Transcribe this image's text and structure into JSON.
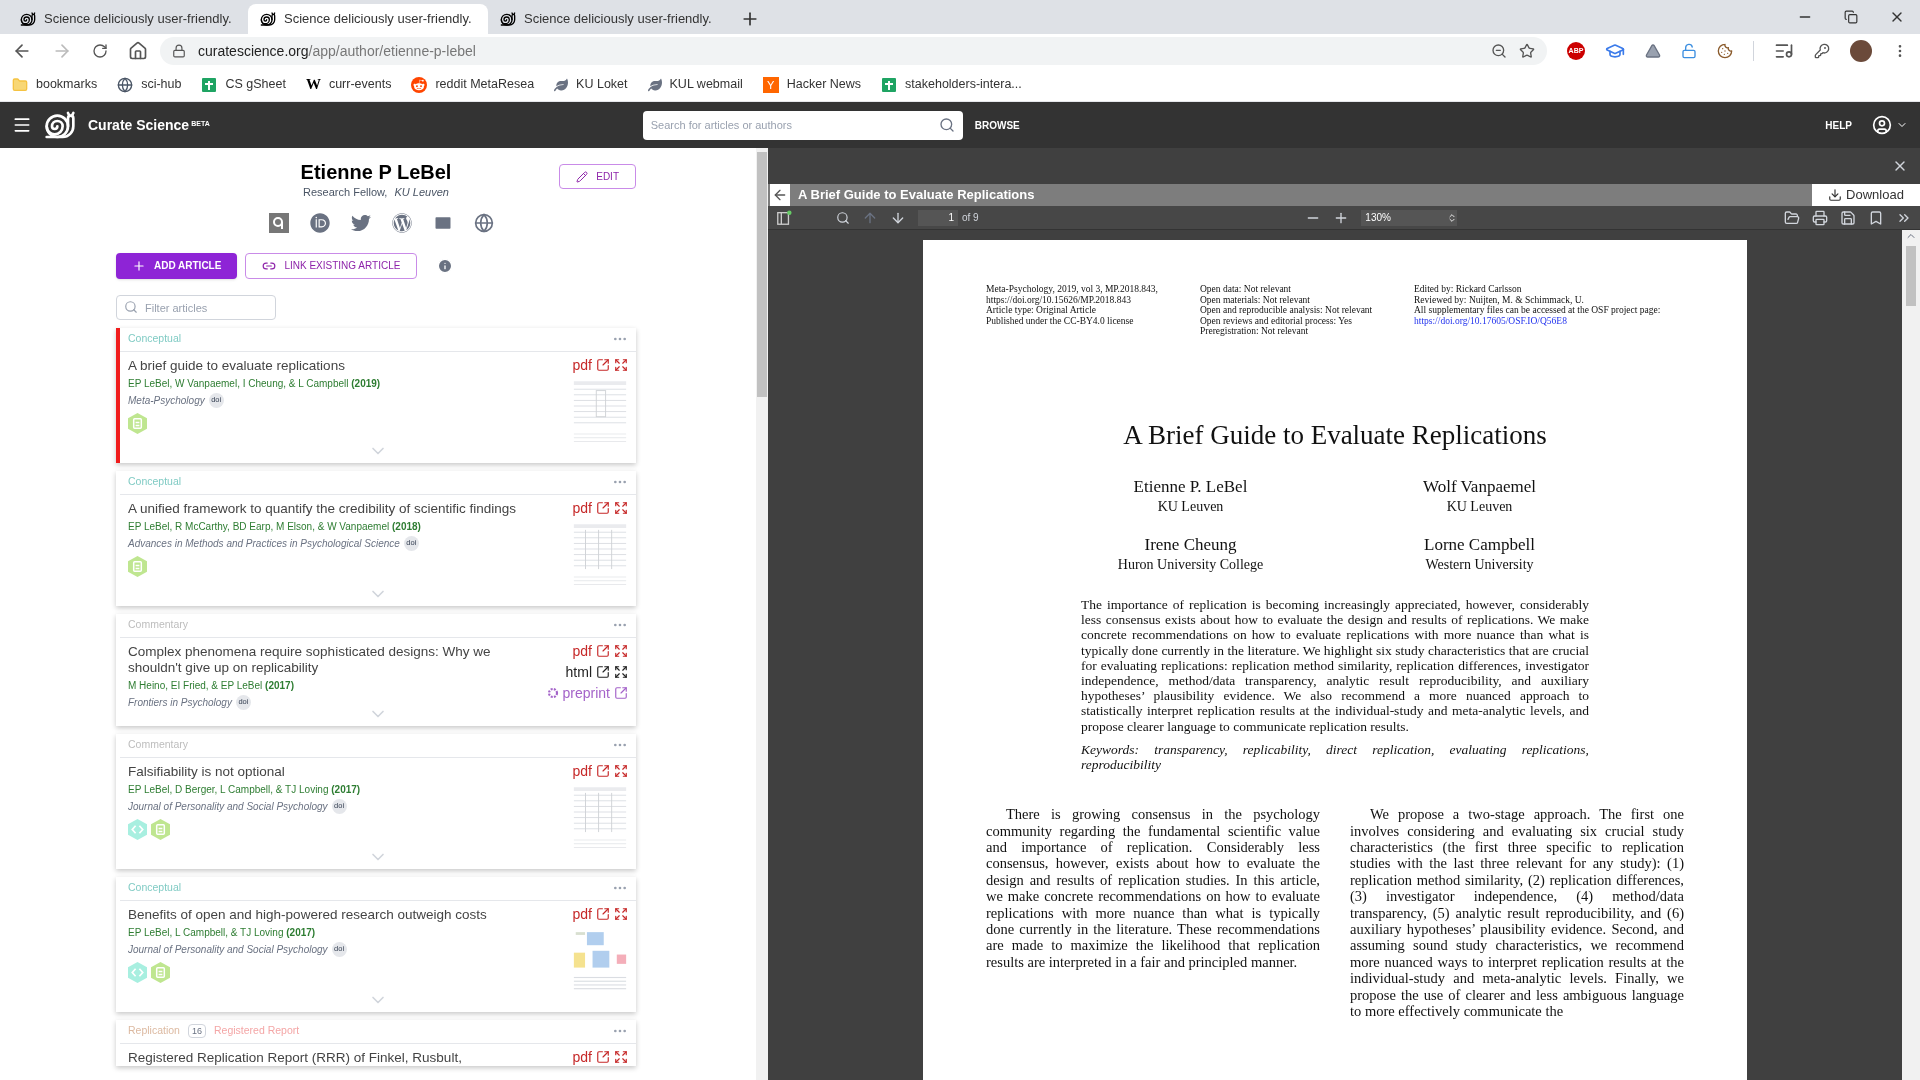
{
  "browser": {
    "tabs": [
      {
        "title": "Science deliciously user-friendly.",
        "selected": false
      },
      {
        "title": "Science deliciously user-friendly.",
        "selected": true
      },
      {
        "title": "Science deliciously user-friendly.",
        "selected": false
      }
    ],
    "url_host": "curatescience.org",
    "url_path": "/app/author/etienne-p-lebel",
    "adblock_label": "ABP",
    "bookmarks": [
      {
        "label": "bookmarks",
        "kind": "folder"
      },
      {
        "label": "sci-hub",
        "kind": "globe"
      },
      {
        "label": "CS gSheet",
        "kind": "sheet"
      },
      {
        "label": "curr-events",
        "kind": "letter",
        "glyph": "W"
      },
      {
        "label": "reddit MetaResea",
        "kind": "reddit"
      },
      {
        "label": "KU Loket",
        "kind": "leaf"
      },
      {
        "label": "KUL webmail",
        "kind": "leaf"
      },
      {
        "label": "Hacker News",
        "kind": "boxed",
        "glyph": "Y"
      },
      {
        "label": "stakeholders-intera...",
        "kind": "sheet"
      }
    ]
  },
  "app_bar": {
    "brand": "Curate Science",
    "badge": "BETA",
    "search_placeholder": "Search for articles or authors",
    "browse": "BROWSE",
    "help": "HELP"
  },
  "profile": {
    "name": "Etienne P LeBel",
    "role": "Research Fellow,",
    "affiliation": "KU Leuven",
    "edit": "EDIT",
    "add_article": "ADD ARTICLE",
    "link_article": "LINK EXISTING ARTICLE",
    "filter_placeholder": "Filter articles"
  },
  "articles": [
    {
      "selected": true,
      "tags": [
        {
          "kind": "type",
          "label": "Conceptual",
          "color": "#80cbc4"
        }
      ],
      "title": "A brief guide to evaluate replications",
      "authors": "EP LeBel, W Vanpaemel, I Cheung, & L Campbell",
      "year": "(2019)",
      "journal": "Meta-Psychology",
      "doi": "doi",
      "badges": [
        {
          "kind": "materials"
        }
      ],
      "links": [
        {
          "kind": "pdf",
          "label": "pdf"
        }
      ],
      "thumbnail": {
        "kind": "figure"
      }
    },
    {
      "selected": false,
      "tags": [
        {
          "kind": "type",
          "label": "Conceptual",
          "color": "#80cbc4"
        }
      ],
      "title": "A unified framework to quantify the credibility of scientific findings",
      "authors": "EP LeBel, R McCarthy, BD Earp, M Elson, & W Vanpaemel",
      "year": "(2018)",
      "journal": "Advances in Methods and Practices in Psychological Science",
      "doi": "doi",
      "badges": [
        {
          "kind": "materials"
        }
      ],
      "links": [
        {
          "kind": "pdf",
          "label": "pdf"
        }
      ],
      "thumbnail": {
        "kind": "table"
      }
    },
    {
      "selected": false,
      "tags": [
        {
          "kind": "type",
          "label": "Commentary",
          "color": "#bdbdbd"
        }
      ],
      "title": "Complex phenomena require sophisticated designs: Why we shouldn't give up on replicability",
      "authors": "M Heino, EI Fried, & EP LeBel",
      "year": "(2017)",
      "journal": "Frontiers in Psychology",
      "doi": "doi",
      "links": [
        {
          "kind": "pdf",
          "label": "pdf"
        },
        {
          "kind": "html",
          "label": "html"
        },
        {
          "kind": "preprint",
          "label": "preprint"
        }
      ]
    },
    {
      "selected": false,
      "tags": [
        {
          "kind": "type",
          "label": "Commentary",
          "color": "#bdbdbd"
        }
      ],
      "title": "Falsifiability is not optional",
      "authors": "EP LeBel, D Berger, L Campbell, & TJ Loving",
      "year": "(2017)",
      "journal": "Journal of Personality and Social Psychology",
      "doi": "doi",
      "badges": [
        {
          "kind": "code"
        },
        {
          "kind": "materials"
        }
      ],
      "links": [
        {
          "kind": "pdf",
          "label": "pdf"
        }
      ],
      "thumbnail": {
        "kind": "table"
      }
    },
    {
      "selected": false,
      "tags": [
        {
          "kind": "type",
          "label": "Conceptual",
          "color": "#80cbc4"
        }
      ],
      "title": "Benefits of open and high-powered research outweigh costs",
      "authors": "EP LeBel, L Campbell, & TJ Loving",
      "year": "(2017)",
      "journal": "Journal of Personality and Social Psychology",
      "doi": "doi",
      "badges": [
        {
          "kind": "code"
        },
        {
          "kind": "materials"
        }
      ],
      "links": [
        {
          "kind": "pdf",
          "label": "pdf"
        }
      ],
      "thumbnail": {
        "kind": "diagram"
      }
    },
    {
      "selected": false,
      "tags": [
        {
          "kind": "type",
          "label": "Replication",
          "color": "#dcb9a0"
        },
        {
          "kind": "count",
          "label": "16"
        },
        {
          "kind": "type",
          "label": "Registered Report",
          "color": "#f4a6a6"
        }
      ],
      "title": "Registered Replication Report (RRR) of Finkel, Rusbult,",
      "links": [
        {
          "kind": "pdf",
          "label": "pdf"
        }
      ]
    }
  ],
  "pdf_viewer": {
    "title": "A Brief Guide to Evaluate Replications",
    "download": "Download",
    "page": "1",
    "page_count": "of 9",
    "zoom": "130%",
    "document": {
      "meta_columns": [
        [
          {
            "kind": "text",
            "text": "Meta-Psychology, 2019, vol 3, MP.2018.843,"
          },
          {
            "kind": "text",
            "text": "https://doi.org/10.15626/MP.2018.843"
          },
          {
            "kind": "text",
            "text": "Article type: Original Article"
          },
          {
            "kind": "text",
            "text": "Published under the CC-BY4.0 license"
          }
        ],
        [
          {
            "kind": "text",
            "text": "Open data: Not relevant"
          },
          {
            "kind": "text",
            "text": "Open materials: Not relevant"
          },
          {
            "kind": "text",
            "text": "Open and reproducible analysis: Not relevant"
          },
          {
            "kind": "text",
            "text": "Open reviews and editorial process: Yes"
          },
          {
            "kind": "text",
            "text": "Preregistration: Not relevant"
          }
        ],
        [
          {
            "kind": "text",
            "text": "Edited by:  Rickard Carlsson"
          },
          {
            "kind": "text",
            "text": "Reviewed by:  Nuijten, M. & Schimmack, U."
          },
          {
            "kind": "text",
            "text": "All supplementary files can be accessed at the OSF project page:"
          },
          {
            "kind": "link",
            "text": "https://doi.org/10.17605/OSF.IO/Q56E8"
          }
        ]
      ],
      "title": "A Brief Guide to Evaluate Replications",
      "authors": [
        {
          "name": "Etienne P. LeBel",
          "affiliation": "KU Leuven"
        },
        {
          "name": "Wolf Vanpaemel",
          "affiliation": "KU Leuven"
        },
        {
          "name": "Irene Cheung",
          "affiliation": "Huron University College"
        },
        {
          "name": "Lorne Campbell",
          "affiliation": "Western University"
        }
      ],
      "abstract": "The importance of replication is becoming increasingly appreciated, however, considerably less consensus exists about how to evaluate the design and results of replications. We make concrete recommendations on how to evaluate replications with more nuance than what is typically done currently in the literature. We highlight six study characteristics that are crucial for evaluating replications: replication method similarity, replication differences, investigator independence, method/data transparency, analytic result reproducibility, and auxiliary hypotheses’ plausibility evidence. We also recommend a more nuanced approach to statistically interpret replication results at the individual-study and meta-analytic levels, and propose clearer language to communicate replication results.",
      "keywords": "Keywords: transparency, replicability, direct replication, evaluating replications, reproducibility",
      "columns": [
        "There is growing consensus in the psychology community regarding the fundamental scientific value and importance of replication. Considerably less consensus, however, exists about how to evaluate the design and results of replication studies. In this article, we make concrete recommendations on how to evaluate replications with more nuance than what is typically done currently in the literature. These recommendations are made to maximize the likelihood that replication results are interpreted in a fair and principled manner.",
        "We propose a two-stage approach. The first one involves considering and evaluating six crucial study characteristics (the first three specific to replication studies with the last three relevant for any study): (1) replication method similarity, (2) replication differences, (3) investigator independence, (4) method/data transparency, (5) analytic result reproducibility, and (6) auxiliary hypotheses’ plausibility evidence. Second, and assuming sound study characteristics, we recommend more nuanced ways to interpret replication results at the individual-study and meta-analytic levels. Finally, we propose the use of clearer and less ambiguous language to more effectively communicate the"
      ]
    }
  }
}
